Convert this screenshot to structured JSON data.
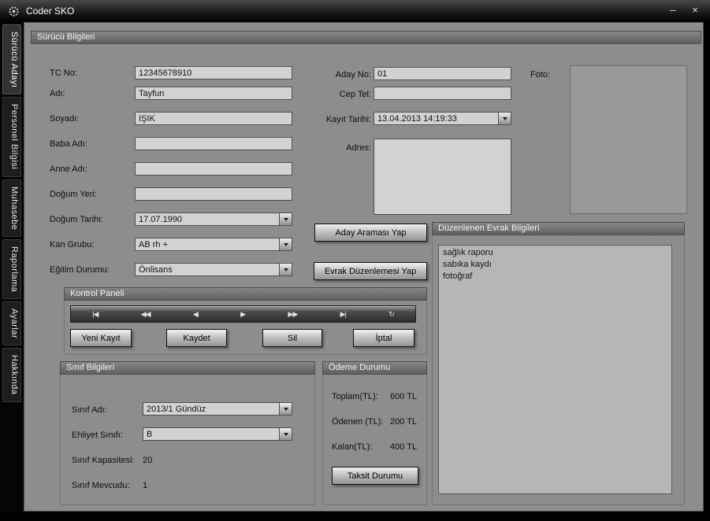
{
  "window": {
    "title": "Coder SKO",
    "minimize": "–",
    "close": "×"
  },
  "sidebar": {
    "tabs": [
      "Sürücü Adayı",
      "Personel Bilgisi",
      "Muhasebe",
      "Raporlama",
      "Ayarlar",
      "Hakkında"
    ]
  },
  "panel": {
    "title": "Sürücü Bilgileri"
  },
  "form_left": [
    {
      "label": "TC No:",
      "value": "12345678910"
    },
    {
      "label": "Adı:",
      "value": "Tayfun"
    },
    {
      "label": "Soyadı:",
      "value": "IŞIK"
    },
    {
      "label": "Baba Adı:",
      "value": ""
    },
    {
      "label": "Anne Adı:",
      "value": ""
    },
    {
      "label": "Doğum Yeri:",
      "value": ""
    },
    {
      "label": "Doğum Tarihi:",
      "value": "17.07.1990"
    },
    {
      "label": "Kan Grubu:",
      "value": "AB rh +"
    },
    {
      "label": "Eğitim Durumu:",
      "value": "Önlisans"
    }
  ],
  "form_mid": {
    "aday_no_label": "Aday No:",
    "aday_no_value": "01",
    "cep_tel_label": "Cep Tel:",
    "cep_tel_value": "",
    "kayit_label": "Kayıt Tarihi:",
    "kayit_value": "13.04.2013 14:19:33",
    "adres_label": "Adres:",
    "adres_value": ""
  },
  "foto": {
    "label": "Foto:"
  },
  "actions": {
    "aday_aramasi": "Aday Araması Yap",
    "evrak_duzenlemesi": "Evrak Düzenlemesi Yap"
  },
  "evrak": {
    "title": "Düzenlenen Evrak Bilgileri",
    "items": [
      "sağlık raporu",
      "sabıka kaydı",
      "fotoğraf"
    ]
  },
  "kontrol": {
    "title": "Kontrol Paneli",
    "nav": [
      "|◀",
      "◀◀",
      "◀",
      "▶",
      "▶▶",
      "▶|",
      "↻"
    ],
    "yeni_kayit": "Yeni Kayıt",
    "kaydet": "Kaydet",
    "sil": "Sil",
    "iptal": "İptal"
  },
  "sinif": {
    "title": "Sınıf Bilgileri",
    "adi_label": "Sınıf Adı:",
    "adi_value": "2013/1 Gündüz",
    "ehliyet_label": "Ehliyet Sınıfı:",
    "ehliyet_value": "B",
    "kapasite_label": "Sınıf Kapasitesi:",
    "kapasite_value": "20",
    "mevcut_label": "Sınıf Mevcudu:",
    "mevcut_value": "1"
  },
  "odeme": {
    "title": "Ödeme Durumu",
    "toplam_label": "Toplam(TL):",
    "toplam_value": "600 TL",
    "odenen_label": "Ödenen (TL):",
    "odenen_value": "200 TL",
    "kalan_label": "Kalan(TL):",
    "kalan_value": "400 TL",
    "taksit": "Taksit Durumu"
  }
}
